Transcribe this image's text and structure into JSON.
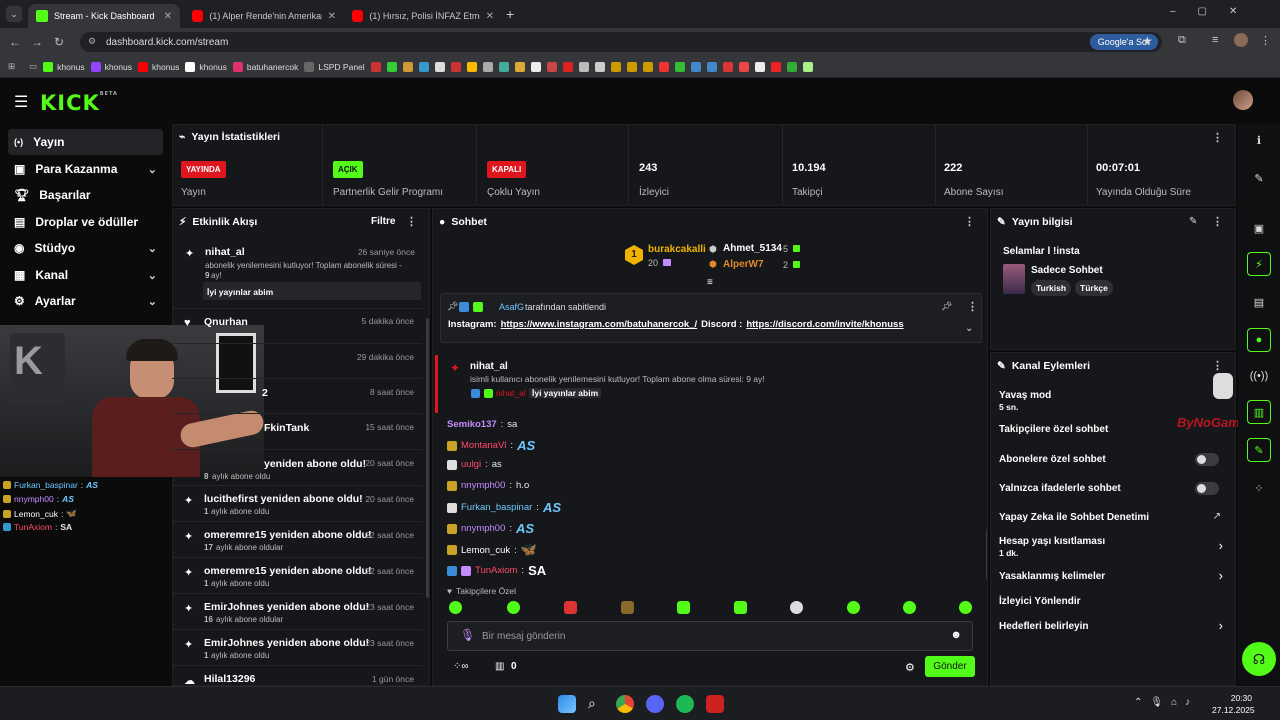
{
  "browser": {
    "tabs": [
      {
        "title": "Stream - Kick Dashboard",
        "active": true
      },
      {
        "title": "(1) Alper Rende'nin Amerikan F..."
      },
      {
        "title": "(1) Hırsız, Polisi İNFAZ Etmeye Ç..."
      }
    ],
    "url": "dashboard.kick.com/stream",
    "google_btn": "Google'a Sor",
    "bookmarks": [
      "khonus",
      "khonus",
      "khonus",
      "khonus",
      "batuhanercok",
      "LSPD Panel"
    ]
  },
  "kick": {
    "logo": "KICK",
    "beta": "BETA",
    "accent": "#53fc18"
  },
  "sidebar": {
    "items": [
      {
        "label": "Yayın",
        "icon": "broadcast-icon"
      },
      {
        "label": "Para Kazanma",
        "icon": "money-icon"
      },
      {
        "label": "Başarılar",
        "icon": "trophy-icon"
      },
      {
        "label": "Droplar ve ödüller",
        "icon": "gift-icon"
      },
      {
        "label": "Stüdyo",
        "icon": "studio-icon"
      },
      {
        "label": "Kanal",
        "icon": "channel-icon"
      },
      {
        "label": "Ayarlar",
        "icon": "gear-icon"
      }
    ]
  },
  "stats": {
    "title": "Yayın İstatistikleri",
    "items": [
      {
        "badge": "YAYINDA",
        "label": "Yayın"
      },
      {
        "badge": "AÇIK",
        "label": "Partnerlik Gelir Programı"
      },
      {
        "badge": "KAPALI",
        "label": "Çoklu Yayın"
      },
      {
        "value": "243",
        "label": "İzleyici"
      },
      {
        "value": "10.194",
        "label": "Takipçi"
      },
      {
        "value": "222",
        "label": "Abone Sayısı"
      },
      {
        "value": "00:07:01",
        "label": "Yayında Olduğu Süre"
      }
    ]
  },
  "activity": {
    "title": "Etkinlik Akışı",
    "filter": "Filtre",
    "first": {
      "name": "nihat_al",
      "time": "26 saniye önce",
      "text": "abonelik yenilemesini kutluyor! Toplam abonelik süresi -",
      "months": "9",
      "months_suffix": "ay!",
      "message": "İyi yayınlar abim"
    },
    "items": [
      {
        "name": "Qnurhan",
        "time": "5 dakika önce"
      },
      {
        "name": "",
        "time": "29 dakika önce"
      },
      {
        "name": "2",
        "time": "8 saat önce"
      },
      {
        "name": "FkinTank",
        "time": "15 saat önce"
      },
      {
        "name": "yeniden abone oldu!",
        "time": "20 saat önce",
        "count": "8",
        "sub": "aylık abone oldu"
      },
      {
        "name": "lucithefirst yeniden abone oldu!",
        "time": "20 saat önce",
        "count": "1",
        "sub": "aylık abone oldu"
      },
      {
        "name": "omeremre15 yeniden abone oldu!",
        "time": "22 saat önce",
        "count": "17",
        "sub": "aylık abone oldular"
      },
      {
        "name": "omeremre15 yeniden abone oldu!",
        "time": "22 saat önce",
        "count": "1",
        "sub": "aylık abone oldu"
      },
      {
        "name": "EmirJohnes yeniden abone oldu!",
        "time": "23 saat önce",
        "count": "16",
        "sub": "aylık abone oldular"
      },
      {
        "name": "EmirJohnes yeniden abone oldu!",
        "time": "23 saat önce",
        "count": "1",
        "sub": "aylık abone oldu"
      },
      {
        "name": "Hilal13296",
        "time": "1 gün önce"
      }
    ]
  },
  "overlay_chat": [
    {
      "user": "Furkan_baspinar",
      "msg": "AS",
      "color": "#6ec8ff"
    },
    {
      "user": "nnymph00",
      "msg": "AS",
      "color": "#c58cff"
    },
    {
      "user": "Lemon_cuk",
      "msg": "🦋",
      "color": "#fff"
    },
    {
      "user": "TunAxiom",
      "msg": "SA",
      "color": "#ff4a6a"
    }
  ],
  "chat": {
    "title": "Sohbet",
    "leaderboard": {
      "first": {
        "rank": "1",
        "name": "burakcakalli",
        "count": "20"
      },
      "second": {
        "name": "Ahmet_5134",
        "count": "5"
      },
      "third": {
        "name": "AlperW7",
        "count": "2"
      }
    },
    "pinned": {
      "by": "AsafG",
      "by_suffix": "tarafından sabitlendi",
      "prefix": "Instagram:",
      "link1": "https://www.instagram.com/batuhanercok_/",
      "mid": "Discord :",
      "link2": "https://discord.com/invite/khonuss"
    },
    "sub_event": {
      "name": "nihat_al",
      "text": "isimli kullanıcı abonelik yenilemesini kutluyor! Toplam abone olma süresi: 9 ay!",
      "user": "nihat_al",
      "msg": "İyi yayınlar abim"
    },
    "messages": [
      {
        "user": "Semiko137",
        "msg": "sa",
        "color": "#c58cff",
        "emote": false
      },
      {
        "user": "MontanaVl",
        "msg": "AS",
        "color": "#ff4a6a",
        "emote": true
      },
      {
        "user": "uulgi",
        "msg": "as",
        "color": "#ff4a6a",
        "emote": false
      },
      {
        "user": "nnymph00",
        "msg": "h.o",
        "color": "#c58cff",
        "emote": false
      },
      {
        "user": "Furkan_baspinar",
        "msg": "AS",
        "color": "#6ec8ff",
        "emote": true
      },
      {
        "user": "nnymph00",
        "msg": "AS",
        "color": "#c58cff",
        "emote": true
      },
      {
        "user": "Lemon_cuk",
        "msg": "🦋",
        "color": "#fff",
        "emote": true
      },
      {
        "user": "TunAxiom",
        "msg": "SA",
        "color": "#ff4a6a",
        "emote": true
      }
    ],
    "followers_only": "Takipçilere Özel",
    "input_placeholder": "Bir mesaj gönderin",
    "count": "0",
    "send": "Gönder"
  },
  "stream_info": {
    "title": "Yayın bilgisi",
    "stream_title": "Selamlar l !insta",
    "category": "Sadece Sohbet",
    "tags": [
      "Turkish",
      "Türkçe"
    ]
  },
  "channel_actions": {
    "title": "Kanal Eylemleri",
    "slow_mode": "Yavaş mod",
    "slow_value": "5 sn.",
    "followers_chat": "Takipçilere özel sohbet",
    "subs_chat": "Abonelere özel sohbet",
    "emotes_chat": "Yalnızca ifadelerle sohbet",
    "ai_moderation": "Yapay Zeka ile Sohbet Denetimi",
    "account_age": "Hesap yaşı kısıtlaması",
    "account_age_value": "1 dk.",
    "banned_words": "Yasaklanmış kelimeler",
    "raid": "İzleyici Yönlendir",
    "goals": "Hedefleri belirleyin"
  },
  "watermark": "ByNoGame",
  "taskbar": {
    "time": "20:30",
    "date": "27.12.2025"
  }
}
